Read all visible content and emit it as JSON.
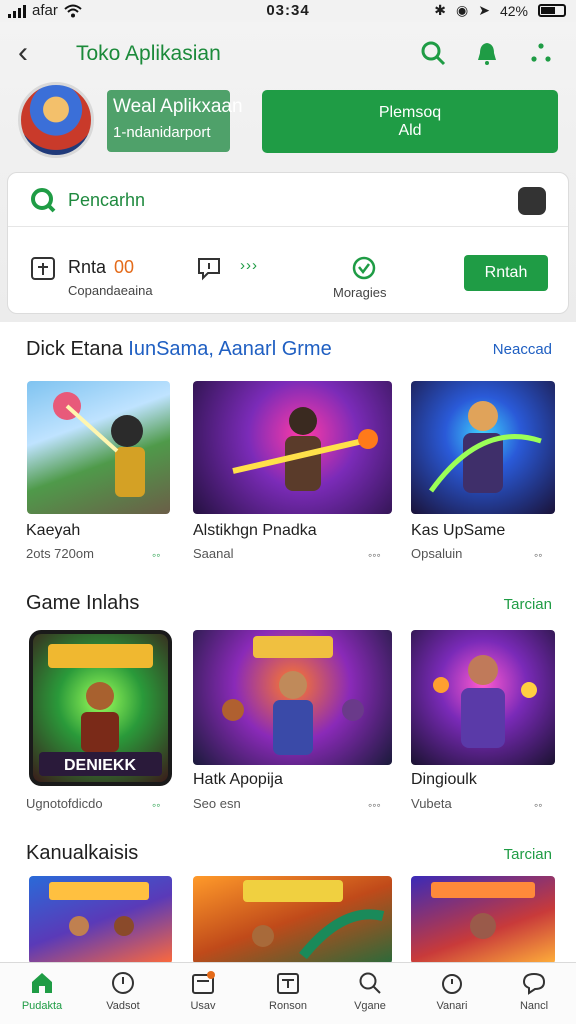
{
  "status_bar": {
    "carrier": "afar",
    "time": "03:34",
    "battery": "42%"
  },
  "header": {
    "back_symbol": "‹",
    "title": "Toko Aplikasian"
  },
  "wallet": {
    "line1": "Weal Aplikxaan",
    "line2": "1-ndanidarport"
  },
  "promo_button": {
    "line1": "Plemsoq",
    "line2": "Ald"
  },
  "search": {
    "label": "Pencarhn"
  },
  "quick": {
    "rnta_label": "Rnta",
    "rnta_value": "00",
    "subtitle": "Copandaeaina",
    "arrows": "›››",
    "merge_label": "Moragies",
    "button_label": "Rntah"
  },
  "sections": [
    {
      "title_prefix": "Dick Etana",
      "title_highlight": "IunSama, Aanarl Grme",
      "link": "Neaccad",
      "games": [
        {
          "name": "Kaeyah",
          "meta": "2ots 720om",
          "dl": "◦◦"
        },
        {
          "name": "Alstikhgn Pnadka",
          "meta": "Saanal",
          "dl": "◦◦◦"
        },
        {
          "name": "Kas UpSame",
          "meta": "Opsaluin",
          "dl": "◦◦"
        }
      ]
    },
    {
      "title": "Game Inlahs",
      "link": "Tarcian",
      "games": [
        {
          "name": "",
          "banner": "DENIEKK",
          "meta": "Ugnotofdicdo",
          "dl": "◦◦"
        },
        {
          "name": "Hatk Apopija",
          "meta": "Seo esn",
          "dl": "◦◦◦"
        },
        {
          "name": "Dingioulk",
          "meta": "Vubeta",
          "dl": "◦◦"
        }
      ]
    },
    {
      "title": "Kanualkaisis",
      "link": "Tarcian",
      "games": []
    }
  ],
  "bottom_nav": [
    {
      "label": "Pudakta",
      "icon": "home-icon"
    },
    {
      "label": "Vadsot",
      "icon": "clock-icon"
    },
    {
      "label": "Usav",
      "icon": "tray-icon"
    },
    {
      "label": "Ronson",
      "icon": "inbox-icon"
    },
    {
      "label": "Vgane",
      "icon": "search-icon"
    },
    {
      "label": "Vanari",
      "icon": "timer-icon"
    },
    {
      "label": "Nancl",
      "icon": "chat-icon"
    }
  ],
  "colors": {
    "accent": "#1f9c45",
    "link_blue": "#1f5fc2",
    "orange": "#e46b1a"
  }
}
